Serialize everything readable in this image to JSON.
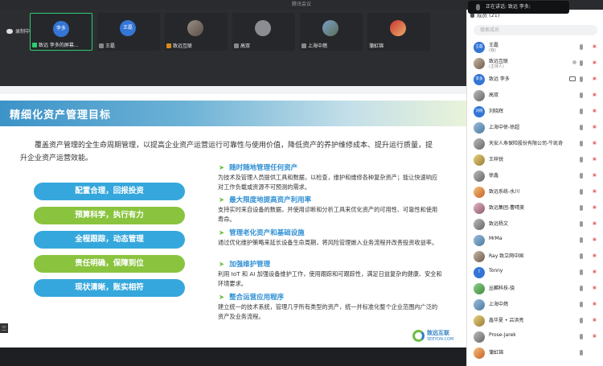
{
  "window": {
    "title": "腾讯会议"
  },
  "speaking": {
    "text": "正在讲话: 致远 李多;"
  },
  "recording": {
    "label": "录制中"
  },
  "video_tiles": [
    {
      "avatar_text": "李多",
      "label": "致远 李多的屏幕..."
    },
    {
      "avatar_text": "王磊",
      "label": "王磊"
    },
    {
      "avatar_text": "",
      "label": "致远互联"
    },
    {
      "avatar_text": "",
      "label": "高双"
    },
    {
      "avatar_text": "",
      "label": "上海中燃"
    },
    {
      "avatar_text": "",
      "label": "蒲虹锦"
    }
  ],
  "slide": {
    "title": "精细化资产管理目标",
    "intro": "覆盖资产管理的全生命周期管理，以提高企业资产运营运行可靠性与使用价值，降低资产的养护维修成本、提升运行质量，提升企业资产运营效能。",
    "pills": [
      {
        "text": "配置合理，回报投资",
        "color": "#35a7dc"
      },
      {
        "text": "预算科学，执行有力",
        "color": "#8ac43f"
      },
      {
        "text": "全程跟踪，动态管理",
        "color": "#35a7dc"
      },
      {
        "text": "责任明确，保障到位",
        "color": "#8ac43f"
      },
      {
        "text": "现状清晰，账实相符",
        "color": "#35a7dc"
      }
    ],
    "items": [
      {
        "title": "随时随地管理任何资产",
        "desc": "为技术及管理人员提供工具和数据，以检查，维护和维修各种复杂资产；能让快速响应对工作负载或资源不可预测的需求。"
      },
      {
        "title": "最大限度地提高资产利用率",
        "desc": "支持实时来自设备的数据，并使用诊断和分析工具来优化资产的可用性、可靠性和使用寿命。"
      },
      {
        "title": "管理老化资产和基础设施",
        "desc": "通过优化维护策略来延长设备生命周期，将风险管理嵌入业务流程并改善投资收益率。"
      },
      {
        "title": "加强维护管理",
        "desc": "利用 IoT 和 AI 加强设备维护工作，使用跟踪和可跟踪性，满足日益复杂的健康、安全和环境要求。"
      },
      {
        "title": "整合运营应用程序",
        "desc": "建立统一的技术系统，管理几乎所有类型的资产，统一并标准化整个企业范围内广泛的资产及业务流程。"
      }
    ],
    "logo": {
      "name": "致远互联",
      "sub": "SEEYON.COM"
    },
    "page_control": "三"
  },
  "members_panel": {
    "header": "成员 (21)",
    "search_placeholder": "搜索成员",
    "members": [
      {
        "avatar": "王磊",
        "name": "王磊",
        "role": "(我)"
      },
      {
        "avatar": "",
        "name": "致远互联",
        "role": "(主持人)"
      },
      {
        "avatar": "李多",
        "name": "致远 李多",
        "role": ""
      },
      {
        "avatar": "",
        "name": "高双",
        "role": ""
      },
      {
        "avatar": "刘晓",
        "name": "刘晓辉",
        "role": ""
      },
      {
        "avatar": "",
        "name": "上海中徐-徐超",
        "role": ""
      },
      {
        "avatar": "",
        "name": "天安人寿保险股份有限公司-牛凯奇",
        "role": ""
      },
      {
        "avatar": "",
        "name": "王梓锐",
        "role": ""
      },
      {
        "avatar": "",
        "name": "徐鑫",
        "role": ""
      },
      {
        "avatar": "",
        "name": "致远系统-水川",
        "role": ""
      },
      {
        "avatar": "",
        "name": "致远集团-曹晴美",
        "role": ""
      },
      {
        "avatar": "",
        "name": "致远杨文",
        "role": ""
      },
      {
        "avatar": "",
        "name": "MrMa",
        "role": ""
      },
      {
        "avatar": "",
        "name": "Ray 致立网中国",
        "role": ""
      },
      {
        "avatar": "T",
        "name": "Tonny",
        "role": ""
      },
      {
        "avatar": "",
        "name": "丛麟科技-骁",
        "role": ""
      },
      {
        "avatar": "",
        "name": "上海中燃",
        "role": ""
      },
      {
        "avatar": "",
        "name": "鑫华夏 • 吕洪亮",
        "role": ""
      },
      {
        "avatar": "",
        "name": "Prose-Jarek",
        "role": ""
      },
      {
        "avatar": "",
        "name": "蒲虹锦",
        "role": ""
      }
    ]
  }
}
